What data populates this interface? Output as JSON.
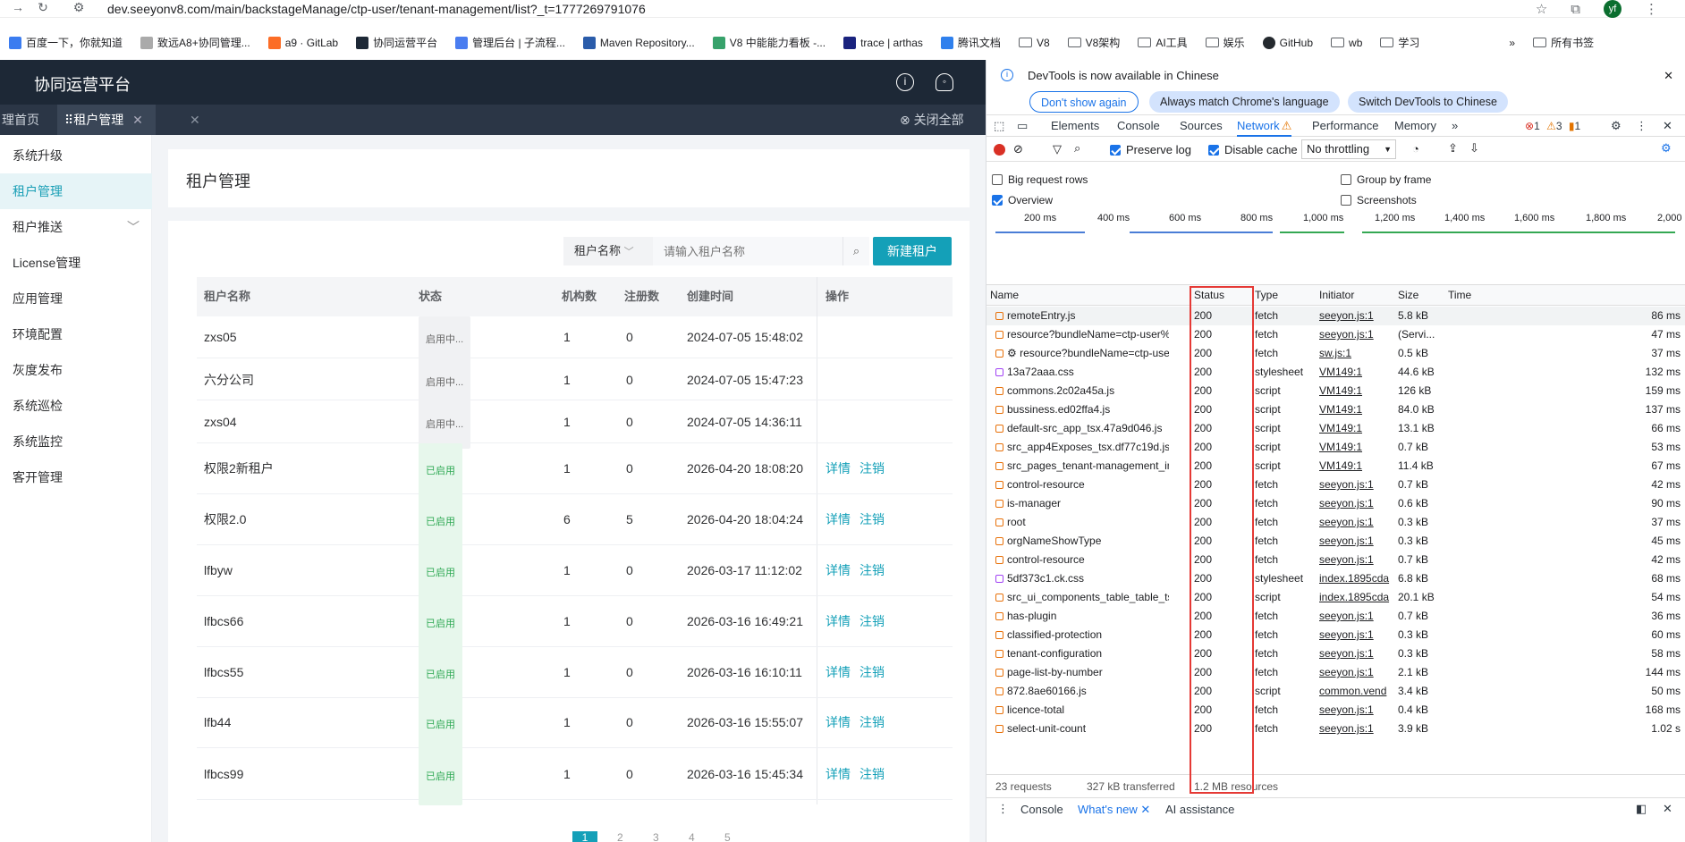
{
  "browser": {
    "url": "dev.seeyonv8.com/main/backstageManage/ctp-user/tenant-management/list?_t=1777269791076",
    "avatar": "yf",
    "bookmarks": [
      "百度一下，你就知道",
      "致远A8+协同管理...",
      "a9 · GitLab",
      "协同运营平台",
      "管理后台 | 子流程...",
      "Maven Repository...",
      "V8 中能能力看板 -...",
      "trace | arthas",
      "腾讯文档",
      "V8",
      "V8架构",
      "AI工具",
      "娱乐",
      "GitHub",
      "wb",
      "学习"
    ],
    "bookmark_more": "»",
    "all_bookmarks": "所有书签"
  },
  "app": {
    "title": "协同运营平台",
    "tabs": {
      "home": "理首页",
      "active": "租户管理",
      "close_all": "关闭全部"
    },
    "sidebar": [
      "系统升级",
      "租户管理",
      "租户推送",
      "License管理",
      "应用管理",
      "环境配置",
      "灰度发布",
      "系统巡检",
      "系统监控",
      "客开管理"
    ],
    "page_title": "租户管理",
    "filter": {
      "select": "租户名称",
      "placeholder": "请输入租户名称",
      "new_button": "新建租户"
    },
    "columns": [
      "租户名称",
      "状态",
      "机构数",
      "注册数",
      "创建时间",
      "操作"
    ],
    "rows": [
      {
        "name": "zxs05",
        "status": "启用中...",
        "orgs": "1",
        "regs": "0",
        "created": "2024-07-05 15:48:02",
        "actions": []
      },
      {
        "name": "六分公司",
        "status": "启用中...",
        "orgs": "1",
        "regs": "0",
        "created": "2024-07-05 15:47:23",
        "actions": []
      },
      {
        "name": "zxs04",
        "status": "启用中...",
        "orgs": "1",
        "regs": "0",
        "created": "2024-07-05 14:36:11",
        "actions": []
      },
      {
        "name": "权限2新租户",
        "status": "已启用",
        "orgs": "1",
        "regs": "0",
        "created": "2026-04-20 18:08:20",
        "actions": [
          "详情",
          "注销"
        ]
      },
      {
        "name": "权限2.0",
        "status": "已启用",
        "orgs": "6",
        "regs": "5",
        "created": "2026-04-20 18:04:24",
        "actions": [
          "详情",
          "注销"
        ]
      },
      {
        "name": "lfbyw",
        "status": "已启用",
        "orgs": "1",
        "regs": "0",
        "created": "2026-03-17 11:12:02",
        "actions": [
          "详情",
          "注销"
        ]
      },
      {
        "name": "lfbcs66",
        "status": "已启用",
        "orgs": "1",
        "regs": "0",
        "created": "2026-03-16 16:49:21",
        "actions": [
          "详情",
          "注销"
        ]
      },
      {
        "name": "lfbcs55",
        "status": "已启用",
        "orgs": "1",
        "regs": "0",
        "created": "2026-03-16 16:10:11",
        "actions": [
          "详情",
          "注销"
        ]
      },
      {
        "name": "lfb44",
        "status": "已启用",
        "orgs": "1",
        "regs": "0",
        "created": "2026-03-16 15:55:07",
        "actions": [
          "详情",
          "注销"
        ]
      },
      {
        "name": "lfbcs99",
        "status": "已启用",
        "orgs": "1",
        "regs": "0",
        "created": "2026-03-16 15:45:34",
        "actions": [
          "详情",
          "注销"
        ]
      }
    ],
    "pager": [
      "1",
      "2",
      "3",
      "4",
      "5"
    ]
  },
  "devtools": {
    "banner": "DevTools is now available in Chinese",
    "chips": [
      "Don't show again",
      "Always match Chrome's language",
      "Switch DevTools to Chinese"
    ],
    "tabs": [
      "Elements",
      "Console",
      "Sources",
      "Network",
      "Performance",
      "Memory"
    ],
    "more_tabs": "»",
    "counts": {
      "errors": "1",
      "warnings": "3",
      "info": "1"
    },
    "toolbar": {
      "preserve": "Preserve log",
      "cache": "Disable cache",
      "throttle": "No throttling"
    },
    "options": [
      "Big request rows",
      "Group by frame",
      "Overview",
      "Screenshots"
    ],
    "timeline_ticks": [
      "200 ms",
      "400 ms",
      "600 ms",
      "800 ms",
      "1,000 ms",
      "1,200 ms",
      "1,400 ms",
      "1,600 ms",
      "1,800 ms",
      "2,000"
    ],
    "columns": [
      "Name",
      "Status",
      "Type",
      "Initiator",
      "Size",
      "Time"
    ],
    "requests": [
      [
        "remoteEntry.js",
        "200",
        "fetch",
        "seeyon.js:1",
        "5.8 kB",
        "86 ms"
      ],
      [
        "resource?bundleName=ctp-user%...",
        "200",
        "fetch",
        "seeyon.js:1",
        "(Servi...",
        "47 ms"
      ],
      [
        "⚙ resource?bundleName=ctp-use...",
        "200",
        "fetch",
        "sw.js:1",
        "0.5 kB",
        "37 ms"
      ],
      [
        "13a72aaa.css",
        "200",
        "stylesheet",
        "VM149:1",
        "44.6 kB",
        "132 ms"
      ],
      [
        "commons.2c02a45a.js",
        "200",
        "script",
        "VM149:1",
        "126 kB",
        "159 ms"
      ],
      [
        "bussiness.ed02ffa4.js",
        "200",
        "script",
        "VM149:1",
        "84.0 kB",
        "137 ms"
      ],
      [
        "default-src_app_tsx.47a9d046.js",
        "200",
        "script",
        "VM149:1",
        "13.1 kB",
        "66 ms"
      ],
      [
        "src_app4Exposes_tsx.df77c19d.js",
        "200",
        "script",
        "VM149:1",
        "0.7 kB",
        "53 ms"
      ],
      [
        "src_pages_tenant-management_in...",
        "200",
        "script",
        "VM149:1",
        "11.4 kB",
        "67 ms"
      ],
      [
        "control-resource",
        "200",
        "fetch",
        "seeyon.js:1",
        "0.7 kB",
        "42 ms"
      ],
      [
        "is-manager",
        "200",
        "fetch",
        "seeyon.js:1",
        "0.6 kB",
        "90 ms"
      ],
      [
        "root",
        "200",
        "fetch",
        "seeyon.js:1",
        "0.3 kB",
        "37 ms"
      ],
      [
        "orgNameShowType",
        "200",
        "fetch",
        "seeyon.js:1",
        "0.3 kB",
        "45 ms"
      ],
      [
        "control-resource",
        "200",
        "fetch",
        "seeyon.js:1",
        "0.7 kB",
        "42 ms"
      ],
      [
        "5df373c1.ck.css",
        "200",
        "stylesheet",
        "index.1895cda",
        "6.8 kB",
        "68 ms"
      ],
      [
        "src_ui_components_table_table_ts...",
        "200",
        "script",
        "index.1895cda",
        "20.1 kB",
        "54 ms"
      ],
      [
        "has-plugin",
        "200",
        "fetch",
        "seeyon.js:1",
        "0.7 kB",
        "36 ms"
      ],
      [
        "classified-protection",
        "200",
        "fetch",
        "seeyon.js:1",
        "0.3 kB",
        "60 ms"
      ],
      [
        "tenant-configuration",
        "200",
        "fetch",
        "seeyon.js:1",
        "0.3 kB",
        "58 ms"
      ],
      [
        "page-list-by-number",
        "200",
        "fetch",
        "seeyon.js:1",
        "2.1 kB",
        "144 ms"
      ],
      [
        "872.8ae60166.js",
        "200",
        "script",
        "common.vend",
        "3.4 kB",
        "50 ms"
      ],
      [
        "licence-total",
        "200",
        "fetch",
        "seeyon.js:1",
        "0.4 kB",
        "168 ms"
      ],
      [
        "select-unit-count",
        "200",
        "fetch",
        "seeyon.js:1",
        "3.9 kB",
        "1.02 s"
      ]
    ],
    "summary": [
      "23 requests",
      "327 kB transferred",
      "1.2 MB resources"
    ],
    "drawer_tabs": [
      "Console",
      "What's new",
      "AI assistance"
    ]
  }
}
